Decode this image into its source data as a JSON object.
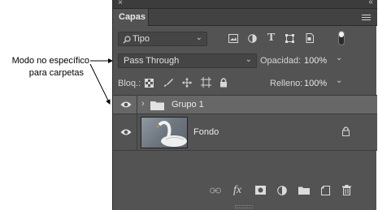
{
  "annotation": {
    "line1": "Modo no específico",
    "line2": "para carpetas"
  },
  "panel": {
    "close_glyph": "×",
    "collapse_glyph": "‹‹",
    "tab_label": "Capas",
    "menu_icon": "hamburger-menu-icon"
  },
  "filter": {
    "kind_label": "Tipo",
    "search_icon": "search-icon",
    "chevron_icon": "chevron-down-icon",
    "filter_icons": [
      "image-filter-icon",
      "adjustment-filter-icon",
      "type-filter-icon",
      "shape-filter-icon",
      "smart-object-filter-icon"
    ],
    "type_glyph": "T"
  },
  "blend": {
    "mode_value": "Pass Through",
    "opacity_label": "Opacidad:",
    "opacity_value": "100%"
  },
  "lock": {
    "label": "Bloq.:",
    "icons": [
      "lock-transparent-pixels-icon",
      "lock-image-pixels-icon",
      "lock-position-icon",
      "lock-artboard-icon",
      "lock-all-icon"
    ],
    "fill_label": "Relleno:",
    "fill_value": "100%"
  },
  "layers": [
    {
      "name": "Grupo 1",
      "type": "group",
      "visible": true
    },
    {
      "name": "Fondo",
      "type": "background",
      "visible": true,
      "locked": true
    }
  ],
  "bottom_icons": [
    "link-layers-icon",
    "fx-icon",
    "layer-mask-icon",
    "adjustment-layer-icon",
    "new-group-icon",
    "new-layer-icon",
    "delete-icon"
  ],
  "fx_label": "fx"
}
